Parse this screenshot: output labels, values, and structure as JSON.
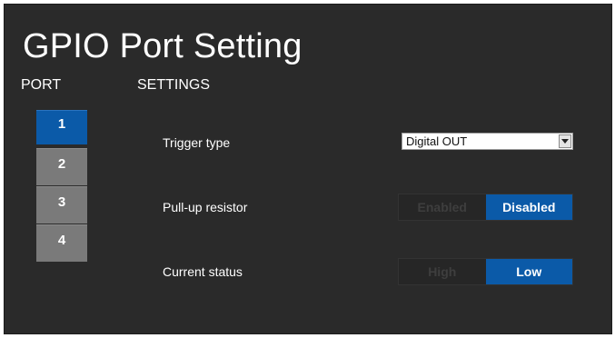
{
  "page": {
    "title": "GPIO Port Setting",
    "port_header": "PORT",
    "settings_header": "SETTINGS"
  },
  "ports": [
    {
      "label": "1",
      "selected": true
    },
    {
      "label": "2",
      "selected": false
    },
    {
      "label": "3",
      "selected": false
    },
    {
      "label": "4",
      "selected": false
    }
  ],
  "settings": {
    "trigger_type": {
      "label": "Trigger type",
      "value": "Digital OUT"
    },
    "pull_up_resistor": {
      "label": "Pull-up resistor",
      "options": [
        "Enabled",
        "Disabled"
      ],
      "selected": "Disabled"
    },
    "current_status": {
      "label": "Current status",
      "options": [
        "High",
        "Low"
      ],
      "selected": "Low"
    }
  },
  "colors": {
    "background": "#2a2a2a",
    "accent": "#0b5aa8",
    "port_inactive": "#7a7a7a",
    "toggle_inactive_text": "#3e3e3e"
  }
}
